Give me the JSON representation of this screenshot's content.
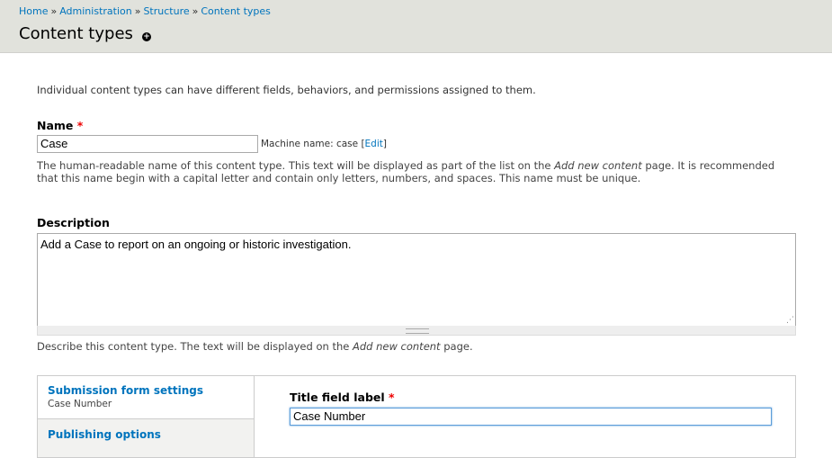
{
  "breadcrumb": {
    "items": [
      "Home",
      "Administration",
      "Structure",
      "Content types"
    ],
    "separator": "»"
  },
  "header": {
    "title": "Content types"
  },
  "intro": "Individual content types can have different fields, behaviors, and permissions assigned to them.",
  "name_field": {
    "label": "Name",
    "required_mark": "*",
    "value": "Case",
    "machine_prefix": "Machine name: case",
    "edit_link": "Edit",
    "help_1": "The human-readable name of this content type. This text will be displayed as part of the list on the ",
    "help_em": "Add new content",
    "help_2": " page. It is recommended",
    "help_line2": "that this name begin with a capital letter and contain only letters, numbers, and spaces. This name must be unique."
  },
  "description_field": {
    "label": "Description",
    "value": "Add a Case to report on an ongoing or historic investigation.",
    "help_1": "Describe this content type. The text will be displayed on the ",
    "help_em": "Add new content",
    "help_2": " page."
  },
  "vertical_tabs": {
    "items": [
      {
        "title": "Submission form settings",
        "summary": "Case Number"
      },
      {
        "title": "Publishing options",
        "summary": ""
      }
    ]
  },
  "title_field": {
    "label": "Title field label",
    "required_mark": "*",
    "value": "Case Number"
  },
  "colors": {
    "link": "#0074bd",
    "header_bg": "#e1e2dc",
    "required": "#ee0000",
    "focus": "#5b9dd9"
  },
  "icons": {
    "add": "plus-circle-icon"
  }
}
